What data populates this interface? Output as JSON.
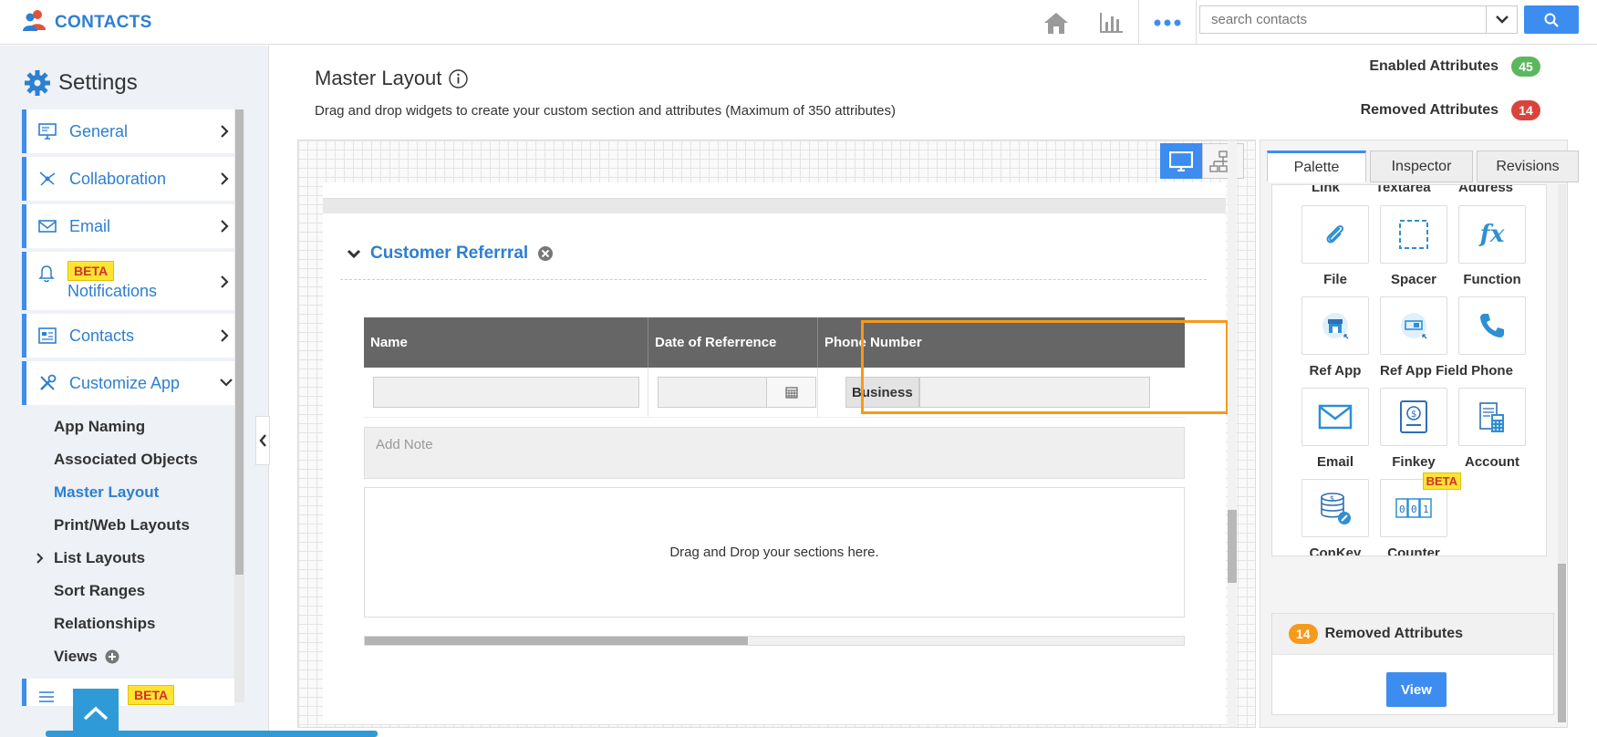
{
  "app": {
    "name": "CONTACTS"
  },
  "search": {
    "placeholder": "search contacts"
  },
  "sidebar": {
    "title": "Settings",
    "items": [
      {
        "label": "General"
      },
      {
        "label": "Collaboration"
      },
      {
        "label": "Email"
      },
      {
        "label": "Notifications",
        "badge": "BETA"
      },
      {
        "label": "Contacts"
      },
      {
        "label": "Customize App"
      }
    ],
    "subitems": [
      {
        "label": "App Naming"
      },
      {
        "label": "Associated Objects"
      },
      {
        "label": "Master Layout",
        "active": true
      },
      {
        "label": "Print/Web Layouts"
      },
      {
        "label": "List Layouts"
      },
      {
        "label": "Sort Ranges"
      },
      {
        "label": "Relationships"
      },
      {
        "label": "Views"
      }
    ],
    "bottom_badge": "BETA"
  },
  "main": {
    "title": "Master Layout",
    "subtitle": "Drag and drop widgets to create your custom section and attributes (Maximum of 350 attributes)",
    "enabled_label": "Enabled Attributes",
    "enabled_count": "45",
    "removed_label": "Removed Attributes",
    "removed_count": "14"
  },
  "section": {
    "name": "Customer Referrral",
    "columns": [
      "Name",
      "Date of Referrence",
      "Phone Number"
    ],
    "phone_type": "Business",
    "note_placeholder": "Add Note",
    "dropzone_text": "Drag and Drop your sections here."
  },
  "palette": {
    "tabs": [
      "Palette",
      "Inspector",
      "Revisions"
    ],
    "top_labels": [
      "Link",
      "Textarea",
      "Address"
    ],
    "widgets": [
      {
        "label": "File",
        "icon": "paperclip-icon"
      },
      {
        "label": "Spacer",
        "icon": "spacer-icon"
      },
      {
        "label": "Function",
        "icon": "function-icon"
      },
      {
        "label": "Ref App",
        "icon": "ref-app-icon"
      },
      {
        "label": "Ref App Field",
        "icon": "ref-app-field-icon"
      },
      {
        "label": "Phone",
        "icon": "phone-icon"
      },
      {
        "label": "Email",
        "icon": "envelope-icon"
      },
      {
        "label": "Finkey",
        "icon": "finkey-icon"
      },
      {
        "label": "Account",
        "icon": "account-icon"
      },
      {
        "label": "ConKey",
        "icon": "conkey-icon"
      },
      {
        "label": "Counter",
        "icon": "counter-icon",
        "badge": "BETA"
      }
    ],
    "removed_count": "14",
    "removed_label": "Removed Attributes",
    "view_button": "View"
  },
  "colors": {
    "accent": "#3d8cf0",
    "brand": "#2d7fd1",
    "enabled_pill": "#5cb85c",
    "removed_pill": "#d9443a",
    "removed_count_pill": "#f59a1b",
    "highlight": "#f59a1b"
  }
}
